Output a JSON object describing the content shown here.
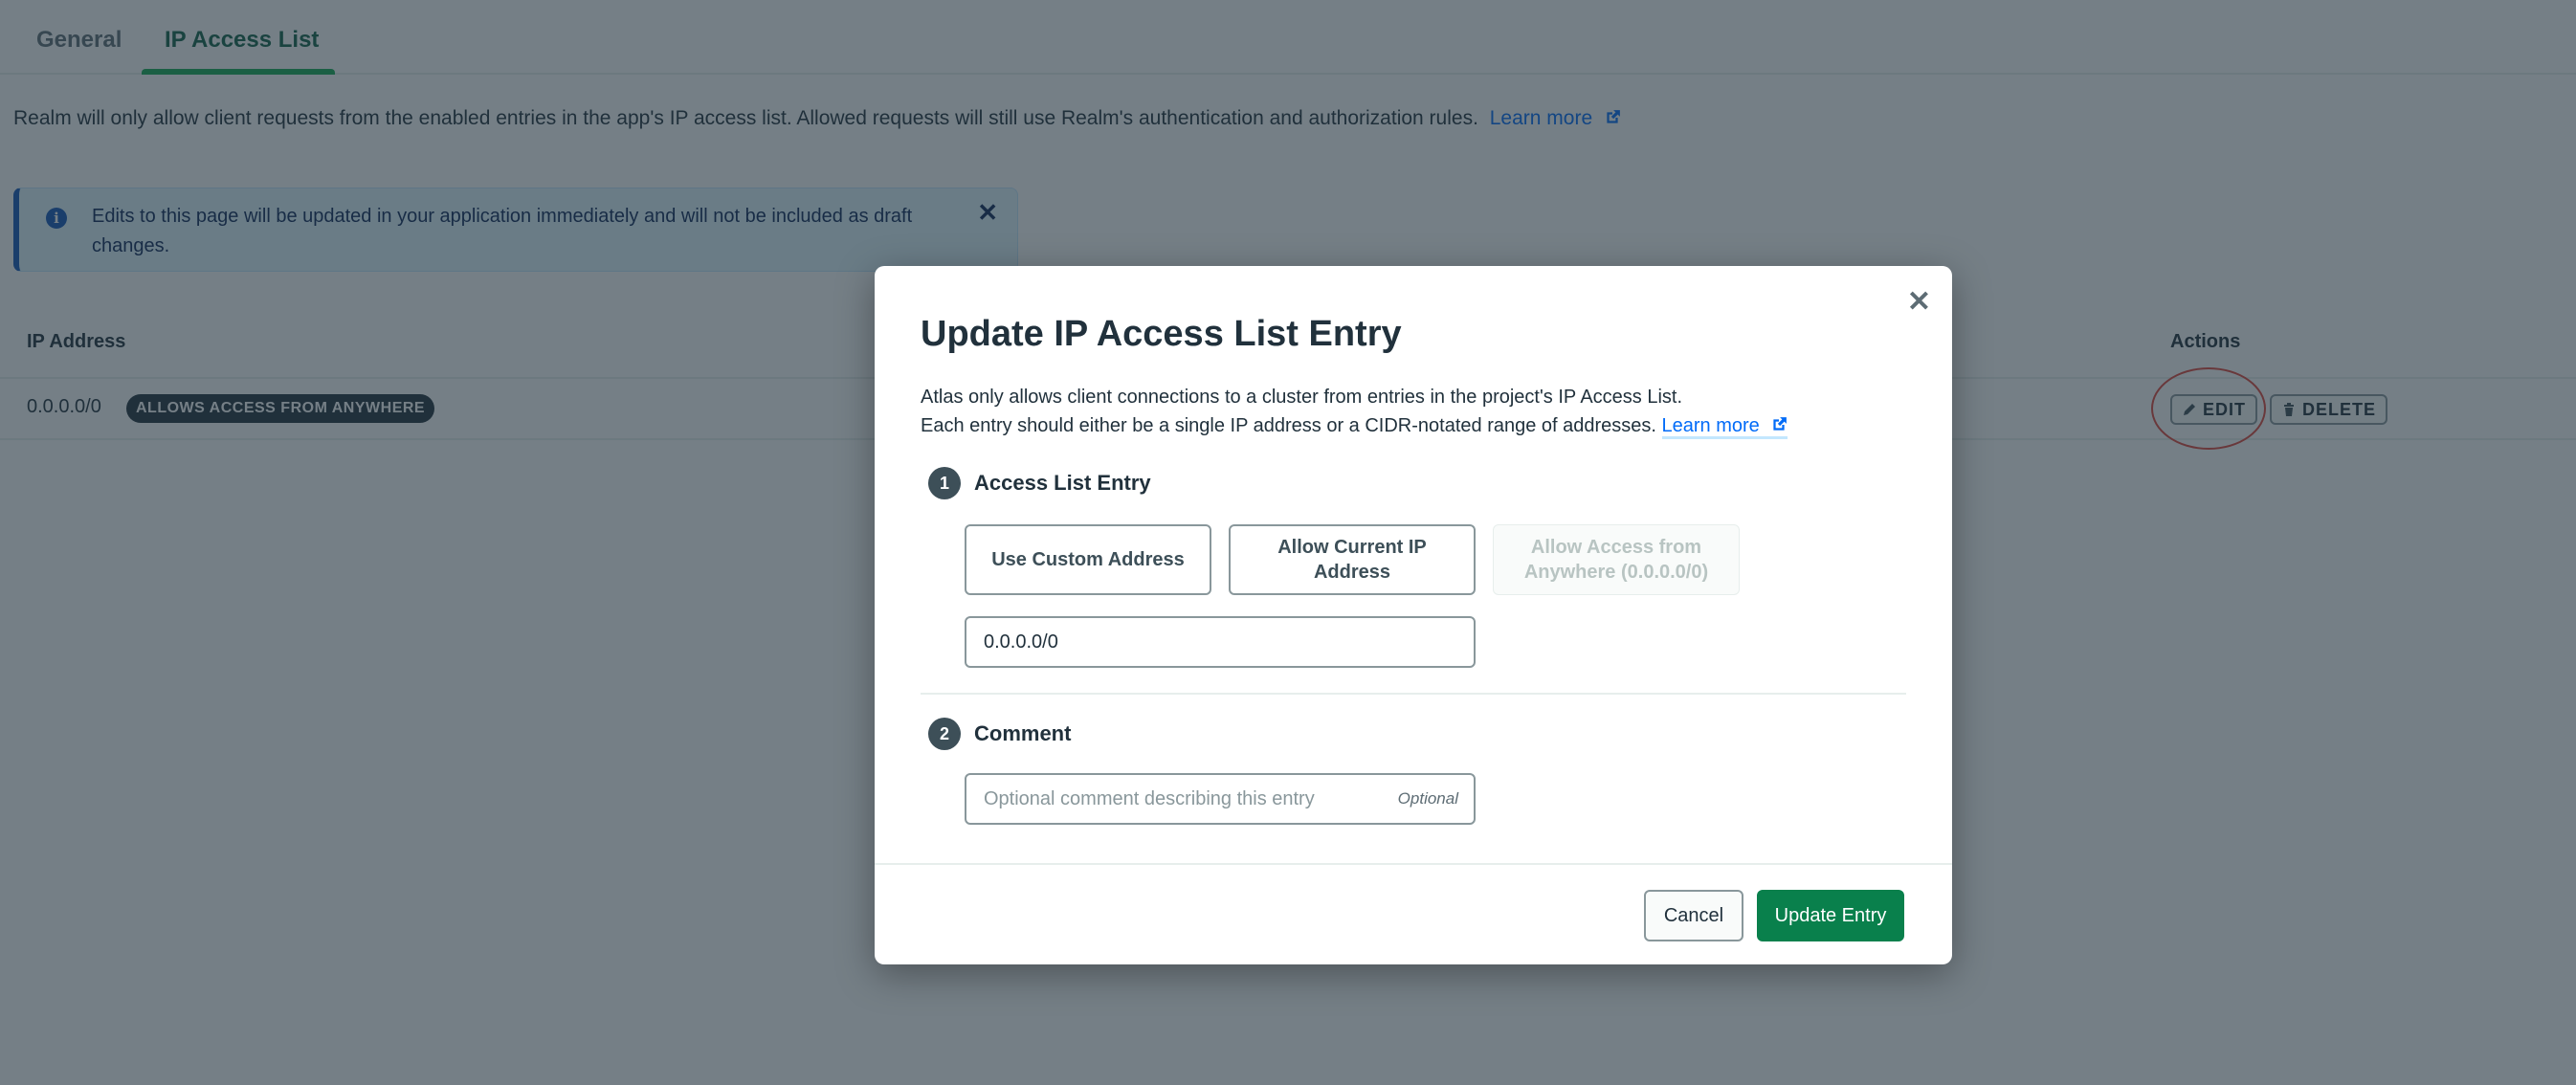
{
  "tabs": [
    {
      "label": "General",
      "active": false
    },
    {
      "label": "IP Access List",
      "active": true
    }
  ],
  "intro": {
    "text": "Realm will only allow client requests from the enabled entries in the app's IP access list. Allowed requests will still use Realm's authentication and authorization rules.",
    "link_label": "Learn more",
    "link_icon": "external-link-icon"
  },
  "banner": {
    "icon": "info-icon",
    "icon_glyph": "i",
    "text": "Edits to this page will be updated in your application immediately and will not be included as draft changes.",
    "close_glyph": "✕"
  },
  "table": {
    "columns": [
      "IP Address",
      "Actions"
    ],
    "rows": [
      {
        "ip": "0.0.0.0/0",
        "badge": "ALLOWS ACCESS FROM ANYWHERE",
        "actions": [
          {
            "label": "EDIT",
            "icon": "pencil-icon"
          },
          {
            "label": "DELETE",
            "icon": "trash-icon"
          }
        ]
      }
    ]
  },
  "modal": {
    "title": "Update IP Access List Entry",
    "close_glyph": "✕",
    "description_line1": "Atlas only allows client connections to a cluster from entries in the project's IP Access List.",
    "description_line2": "Each entry should either be a single IP address or a CIDR-notated range of addresses.",
    "learn_more": "Learn more",
    "step1": {
      "number": "1",
      "label": "Access List Entry",
      "options": [
        {
          "label": "Use Custom Address",
          "disabled": false
        },
        {
          "label": "Allow Current IP Address",
          "disabled": false
        },
        {
          "label": "Allow Access from Anywhere (0.0.0.0/0)",
          "disabled": true
        }
      ],
      "ip_value": "0.0.0.0/0"
    },
    "step2": {
      "number": "2",
      "label": "Comment",
      "placeholder": "Optional comment describing this entry",
      "optional_tag": "Optional"
    },
    "cancel_label": "Cancel",
    "submit_label": "Update Entry"
  },
  "colors": {
    "primary_green": "#09804c",
    "tab_active": "#13aa52",
    "link": "#016bf8",
    "highlight_ring": "#e0453a"
  }
}
